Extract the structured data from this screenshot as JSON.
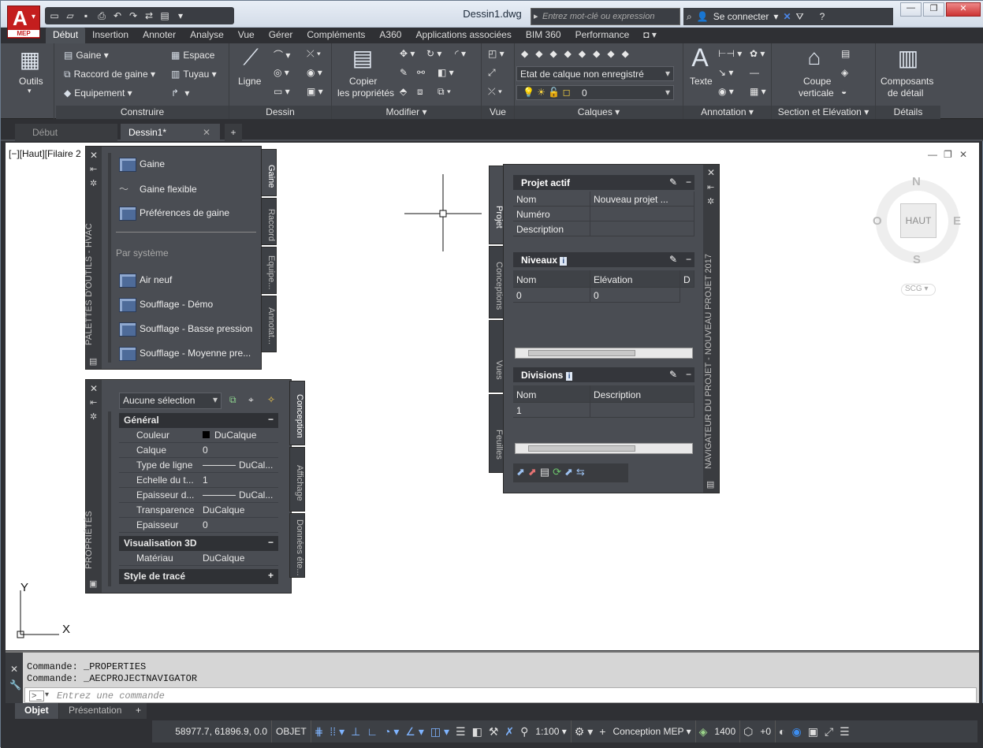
{
  "app": {
    "badge": "MEP",
    "letter": "A"
  },
  "title_bar": {
    "document": "Dessin1.dwg",
    "search_placeholder": "Entrez mot-clé ou expression",
    "signin": "Se connecter"
  },
  "ribbon_tabs": [
    "Début",
    "Insertion",
    "Annoter",
    "Analyse",
    "Vue",
    "Gérer",
    "Compléments",
    "A360",
    "Applications associées",
    "BIM 360",
    "Performance"
  ],
  "ribbon": {
    "outils": "Outils",
    "construire": {
      "label": "Construire",
      "gaine": "Gaine",
      "raccord": "Raccord de gaine",
      "equipement": "Equipement",
      "espace": "Espace",
      "tuyau": "Tuyau"
    },
    "dessin": {
      "label": "Dessin",
      "ligne": "Ligne"
    },
    "modifier": {
      "label": "Modifier",
      "copier_l1": "Copier",
      "copier_l2": "les propriétés"
    },
    "vue": {
      "label": "Vue"
    },
    "calques": {
      "label": "Calques",
      "etat": "Etat de calque non enregistré",
      "layer": "0"
    },
    "annotation": {
      "label": "Annotation",
      "texte": "Texte"
    },
    "section": {
      "label": "Section et Elévation",
      "coupe_l1": "Coupe",
      "coupe_l2": "verticale"
    },
    "details": {
      "label": "Détails",
      "comp_l1": "Composants",
      "comp_l2": "de détail"
    }
  },
  "doc_tabs": {
    "debut": "Début",
    "dessin": "Dessin1*"
  },
  "viewport": {
    "label": "[−][Haut][Filaire 2"
  },
  "viewcube": {
    "n": "N",
    "s": "S",
    "e": "E",
    "o": "O",
    "face": "HAUT",
    "scg": "SCG"
  },
  "tool_palette": {
    "title": "PALETTES D'OUTILS - HVAC",
    "tools": [
      "Gaine",
      "Gaine flexible",
      "Préférences de gaine"
    ],
    "section": "Par système",
    "system_tools": [
      "Air neuf",
      "Soufflage - Démo",
      "Soufflage - Basse pression",
      "Soufflage -  Moyenne pre..."
    ],
    "tabs": [
      "Gaine",
      "Raccord",
      "Equipe...",
      "Annotat..."
    ]
  },
  "properties": {
    "title": "PROPRIÉTÉS",
    "selection": "Aucune sélection",
    "general": "Général",
    "rows": [
      {
        "k": "Couleur",
        "v": "DuCalque"
      },
      {
        "k": "Calque",
        "v": "0"
      },
      {
        "k": "Type de ligne",
        "v": "DuCal..."
      },
      {
        "k": "Echelle du t...",
        "v": "1"
      },
      {
        "k": "Epaisseur  d...",
        "v": "DuCal..."
      },
      {
        "k": "Transparence",
        "v": "DuCalque"
      },
      {
        "k": "Epaisseur",
        "v": "0"
      }
    ],
    "vis3d": "Visualisation 3D",
    "materiau_k": "Matériau",
    "materiau_v": "DuCalque",
    "style": "Style de tracé",
    "tabs": [
      "Conception",
      "Affichage",
      "Données éte..."
    ]
  },
  "navigator": {
    "title": "NAVIGATEUR DU PROJET - NOUVEAU PROJET 2017",
    "tabs": [
      "Projet",
      "Conceptions",
      "Vues",
      "Feuilles"
    ],
    "projet_actif": "Projet actif",
    "fields": [
      {
        "k": "Nom",
        "v": "Nouveau projet ..."
      },
      {
        "k": "Numéro",
        "v": ""
      },
      {
        "k": "Description",
        "v": ""
      }
    ],
    "niveaux": "Niveaux",
    "niveaux_cols": [
      "Nom",
      "Elévation",
      "D"
    ],
    "niveaux_row": [
      "0",
      "0"
    ],
    "divisions": "Divisions",
    "divisions_cols": [
      "Nom",
      "Description"
    ],
    "divisions_row": [
      "1",
      ""
    ]
  },
  "ucs": {
    "x": "X",
    "y": "Y"
  },
  "command": {
    "line1": "Commande:  _PROPERTIES",
    "line2": "Commande:  _AECPROJECTNAVIGATOR",
    "placeholder": "Entrez une commande"
  },
  "layout_tabs": {
    "objet": "Objet",
    "presentation": "Présentation"
  },
  "status": {
    "coords": "58977.7, 61896.9, 0.0",
    "objet": "OBJET",
    "scale": "1:100",
    "config": "Conception MEP",
    "elev": "1400",
    "plus": "+0"
  }
}
